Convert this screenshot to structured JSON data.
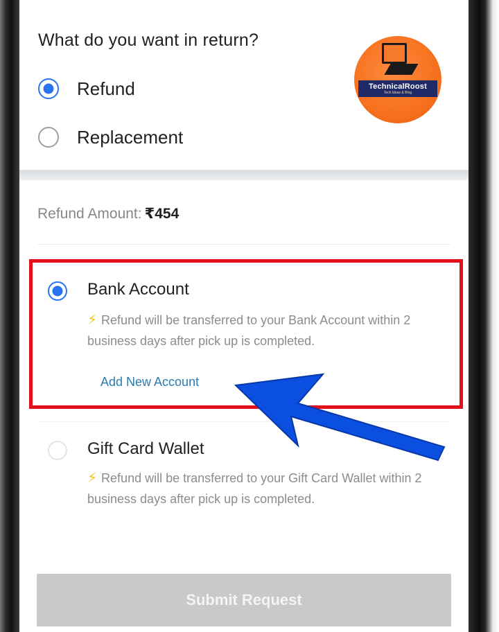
{
  "return_section": {
    "title": "What do you want in return?",
    "options": [
      {
        "label": "Refund",
        "selected": true
      },
      {
        "label": "Replacement",
        "selected": false
      }
    ]
  },
  "logo": {
    "text": "TechnicalRoost",
    "subtext": "Tech Ideas & Blog",
    "icon": "computer-monitor-icon",
    "color": "#f56f1d"
  },
  "refund": {
    "amount_label": "Refund Amount:",
    "amount_value": "₹454",
    "methods": [
      {
        "title": "Bank Account",
        "selected": true,
        "description": "Refund will be transferred to your Bank Account within 2 business days after pick up is completed.",
        "link": "Add New Account"
      },
      {
        "title": "Gift Card Wallet",
        "selected": false,
        "description": "Refund will be transferred to your Gift Card Wallet within 2 business days after pick up is completed."
      }
    ]
  },
  "submit_label": "Submit Request",
  "colors": {
    "accent": "#2874f0",
    "highlight": "#e3101a",
    "arrow": "#0a4fe0",
    "link": "#2a7cb0",
    "disabled_button": "#c9c9c9"
  }
}
